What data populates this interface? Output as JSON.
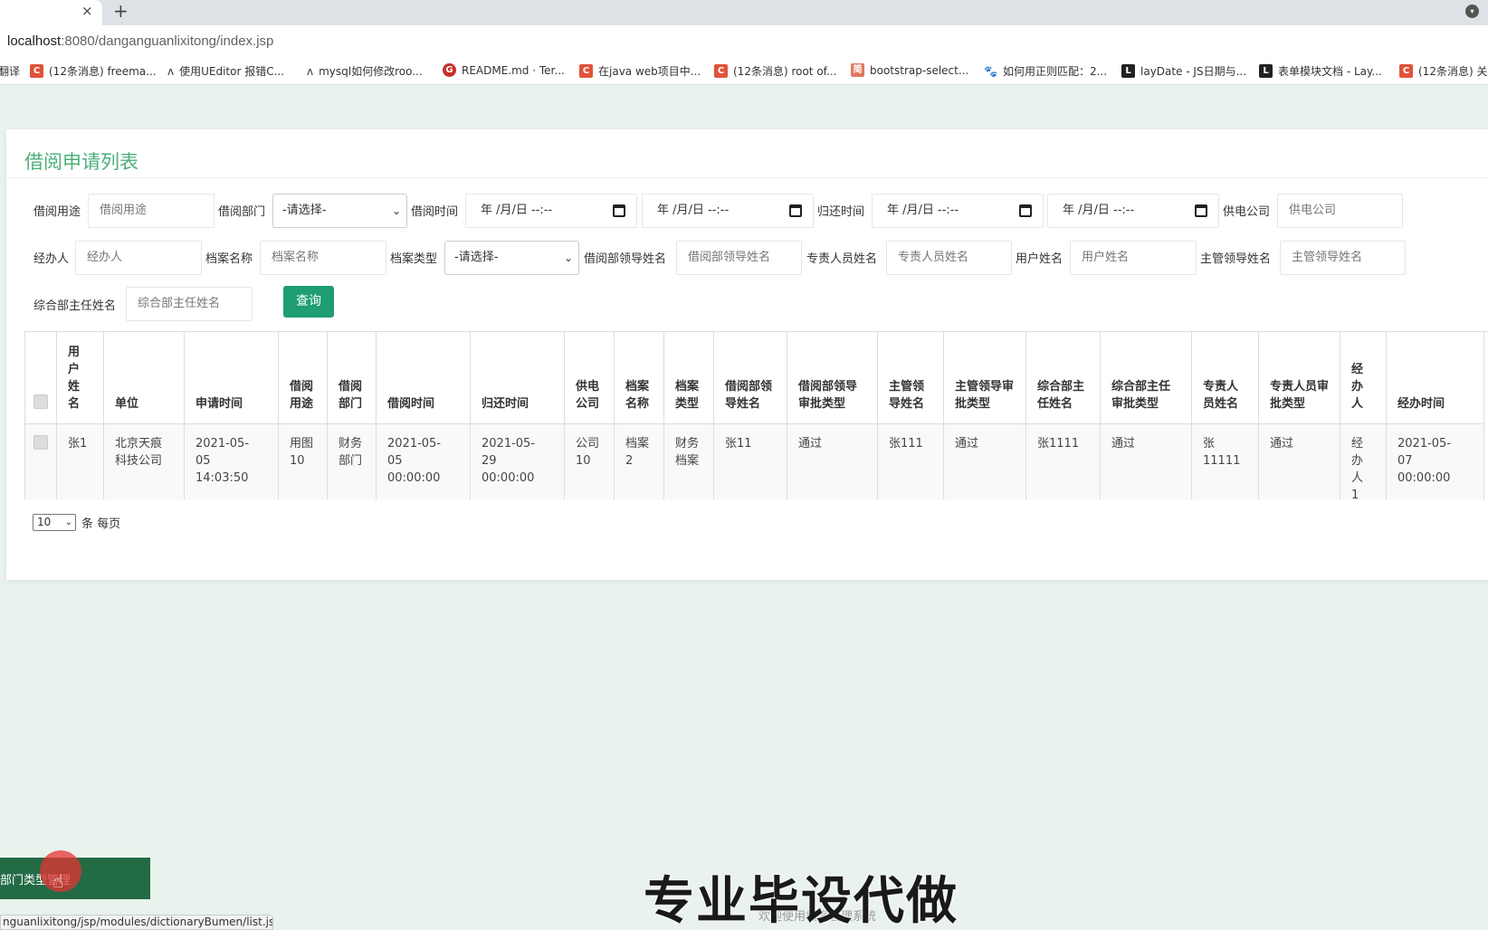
{
  "browser": {
    "tab_close": "×",
    "new_tab": "+",
    "url_host": "localhost",
    "url_path": ":8080/danganguanlixitong/index.jsp",
    "bookmarks": [
      {
        "icon": "",
        "label": "翻译"
      },
      {
        "icon": "C",
        "label": "(12条消息) freema..."
      },
      {
        "icon": "ʌ",
        "label": "使用UEditor 报错C..."
      },
      {
        "icon": "ʌ",
        "label": "mysql如何修改roo..."
      },
      {
        "icon": "G",
        "label": "README.md · Ter..."
      },
      {
        "icon": "C",
        "label": "在java web项目中..."
      },
      {
        "icon": "C",
        "label": "(12条消息) root of..."
      },
      {
        "icon": "简",
        "label": "bootstrap-select..."
      },
      {
        "icon": "🐾",
        "label": "如何用正则匹配：2..."
      },
      {
        "icon": "L",
        "label": "layDate - JS日期与..."
      },
      {
        "icon": "L",
        "label": "表单模块文档 - Lay..."
      },
      {
        "icon": "C",
        "label": "(12条消息) 关"
      }
    ],
    "status_url": "nguanlixitong/jsp/modules/dictionaryBumen/list.jsp"
  },
  "page": {
    "title": "借阅申请列表",
    "search": {
      "jieyue_yongtu": {
        "label": "借阅用途",
        "placeholder": "借阅用途"
      },
      "jieyue_bumen": {
        "label": "借阅部门",
        "selected": "-请选择-"
      },
      "jieyue_time": {
        "label": "借阅时间",
        "start": "年 /月/日  --:--",
        "end": "年 /月/日  --:--"
      },
      "guihuan_time": {
        "label": "归还时间",
        "start": "年 /月/日  --:--",
        "end": "年 /月/日  --:--"
      },
      "gongdian_gongsi": {
        "label": "供电公司",
        "placeholder": "供电公司"
      },
      "jingbanren": {
        "label": "经办人",
        "placeholder": "经办人"
      },
      "dangan_name": {
        "label": "档案名称",
        "placeholder": "档案名称"
      },
      "dangan_type": {
        "label": "档案类型",
        "selected": "-请选择-"
      },
      "jieyue_leader": {
        "label": "借阅部领导姓名",
        "placeholder": "借阅部领导姓名"
      },
      "zhuanze": {
        "label": "专责人员姓名",
        "placeholder": "专责人员姓名"
      },
      "yonghu": {
        "label": "用户姓名",
        "placeholder": "用户姓名"
      },
      "zhuguan": {
        "label": "主管领导姓名",
        "placeholder": "主管领导姓名"
      },
      "zonghe": {
        "label": "综合部主任姓名",
        "placeholder": "综合部主任姓名"
      },
      "query_button": "查询"
    },
    "table": {
      "columns": [
        "用户姓名",
        "单位",
        "申请时间",
        "借阅用途",
        "借阅部门",
        "借阅时间",
        "归还时间",
        "供电公司",
        "档案名称",
        "档案类型",
        "借阅部领导姓名",
        "借阅部领导审批类型",
        "主管领导姓名",
        "主管领导审批类型",
        "综合部主任姓名",
        "综合部主任审批类型",
        "专责人员姓名",
        "专责人员审批类型",
        "经办人",
        "经办时间"
      ],
      "rows": [
        [
          "张1",
          "北京天痕科技公司",
          "2021-05-05 14:03:50",
          "用图10",
          "财务部门",
          "2021-05-05 00:00:00",
          "2021-05-29 00:00:00",
          "公司10",
          "档案2",
          "财务档案",
          "张11",
          "通过",
          "张111",
          "通过",
          "张1111",
          "通过",
          "张11111",
          "通过",
          "经办人1",
          "2021-05-07 00:00:00"
        ]
      ]
    },
    "pager": {
      "page_size": "10",
      "suffix": "条 每页"
    }
  },
  "overlay": {
    "sidebar_fragment": "部门类型管理",
    "watermark": "专业毕设代做",
    "footer": "欢迎使用档案管理系统"
  }
}
